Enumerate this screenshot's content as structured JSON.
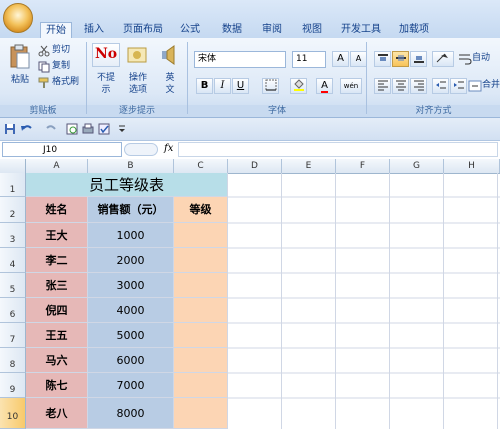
{
  "ribbon": {
    "tabs": [
      "开始",
      "插入",
      "页面布局",
      "公式",
      "数据",
      "审阅",
      "视图",
      "开发工具",
      "加载项"
    ],
    "clipboard": {
      "paste": "粘贴",
      "cut": "剪切",
      "copy": "复制",
      "format_painter": "格式刷",
      "group": "剪贴板"
    },
    "steps": {
      "no_prompt_line1": "不提",
      "no_prompt_line2": "示",
      "no_icon_text": "No",
      "ops_line1": "操作",
      "ops_line2": "选项",
      "en_line1": "英",
      "en_line2": "文",
      "group": "逐步提示"
    },
    "font": {
      "name": "宋体",
      "size": "11",
      "group": "字体",
      "bold": "B",
      "italic": "I",
      "underline": "U",
      "grow": "A",
      "shrink": "A",
      "font_color": "A",
      "phonetic": "wén"
    },
    "alignment": {
      "group": "对齐方式",
      "wrap": "自动",
      "merge": "合并"
    }
  },
  "formula_bar": {
    "cell_ref": "J10",
    "fx": "fx"
  },
  "sheet": {
    "columns": [
      "A",
      "B",
      "C",
      "D",
      "E",
      "F",
      "G",
      "H"
    ],
    "rows": [
      "1",
      "2",
      "3",
      "4",
      "5",
      "6",
      "7",
      "8",
      "9",
      "10"
    ],
    "title": "员工等级表",
    "headers": [
      "姓名",
      "销售额（元）",
      "等级"
    ],
    "data": [
      {
        "name": "王大",
        "sales": "1000"
      },
      {
        "name": "李二",
        "sales": "2000"
      },
      {
        "name": "张三",
        "sales": "3000"
      },
      {
        "name": "倪四",
        "sales": "4000"
      },
      {
        "name": "王五",
        "sales": "5000"
      },
      {
        "name": "马六",
        "sales": "6000"
      },
      {
        "name": "陈七",
        "sales": "7000"
      },
      {
        "name": "老八",
        "sales": "8000"
      }
    ],
    "selected_row": "10"
  },
  "colors": {
    "name_fill": "#e6b8b7",
    "sales_fill": "#b8cce4",
    "grade_fill": "#fcd5b4",
    "title_fill": "#b7dee8"
  }
}
